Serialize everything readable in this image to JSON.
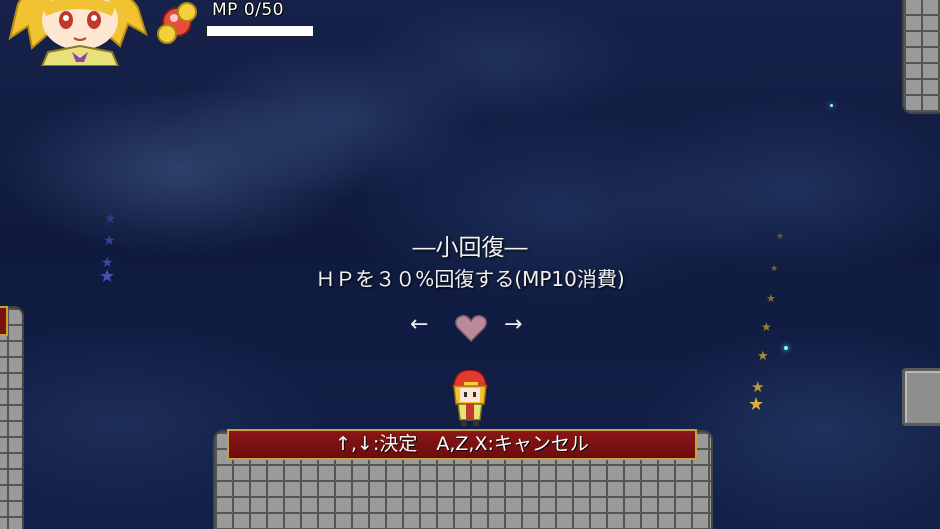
{
  "hud": {
    "mp_label": "MP 0/50",
    "mp_fraction": 0.0
  },
  "skill": {
    "title": "―小回復―",
    "description": "ＨＰを３０%回復する(MP10消費)",
    "prev_arrow": "←",
    "next_arrow": "→",
    "icon": "heart-icon"
  },
  "controls": {
    "text": "↑,↓:決定　A,Z,X:キャンセル"
  },
  "colors": {
    "banner_red": "#7a1010",
    "banner_gold": "#c8a040",
    "heart": "#b98a9a",
    "star_gold": "#d8b03a",
    "star_blue": "#3a4aa8"
  }
}
